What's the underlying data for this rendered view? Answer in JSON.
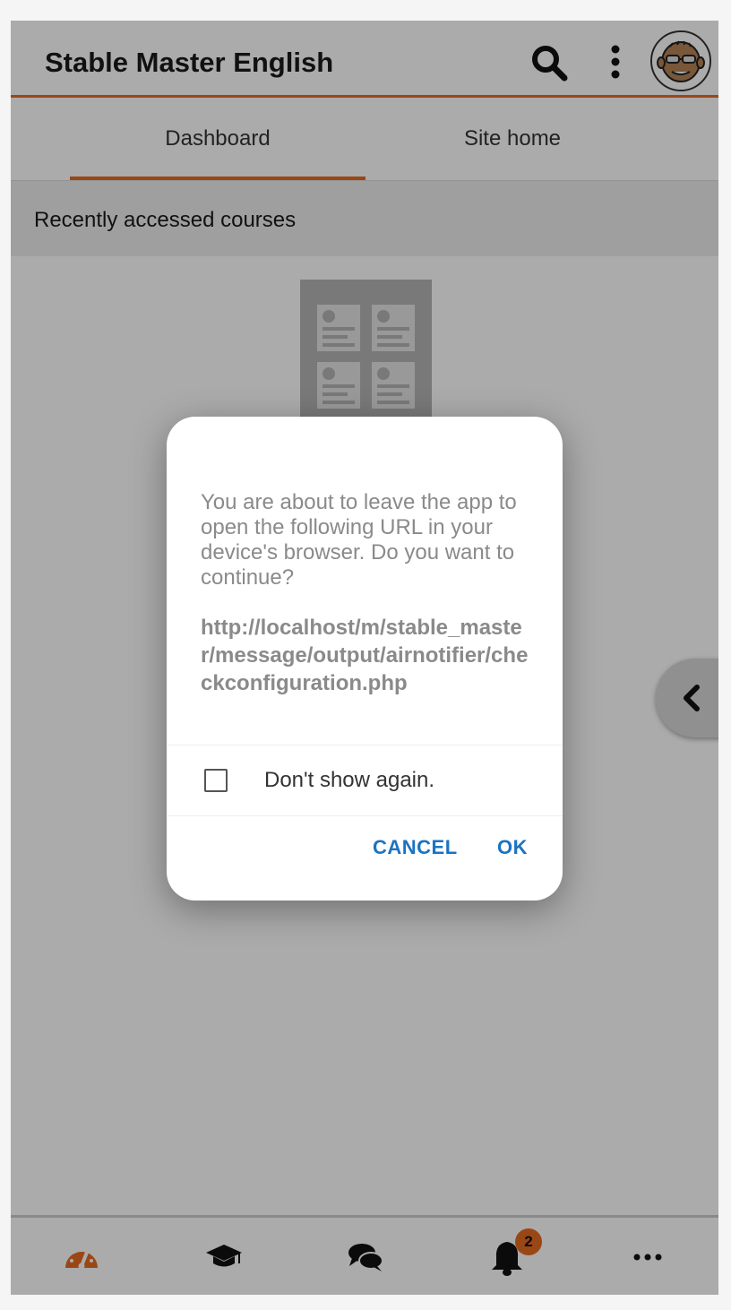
{
  "header": {
    "title": "Stable Master English",
    "search_icon": "search-icon",
    "more_icon": "kebab-menu-icon",
    "avatar": "user-avatar"
  },
  "tabs": [
    {
      "label": "Dashboard",
      "active": true
    },
    {
      "label": "Site home",
      "active": false
    }
  ],
  "section": {
    "title": "Recently accessed courses"
  },
  "bottom_nav": [
    {
      "name": "dashboard",
      "icon": "gauge-icon",
      "active": true
    },
    {
      "name": "courses",
      "icon": "graduation-cap-icon"
    },
    {
      "name": "messages",
      "icon": "chat-bubbles-icon"
    },
    {
      "name": "notifications",
      "icon": "bell-icon",
      "badge": "2"
    },
    {
      "name": "more",
      "icon": "ellipsis-icon"
    }
  ],
  "dialog": {
    "message": "You are about to leave the app to open the following URL in your device's browser. Do you want to continue?",
    "url": "http://localhost/m/stable_master/message/output/airnotifier/checkconfiguration.php",
    "checkbox_label": "Don't show again.",
    "checkbox_checked": false,
    "cancel_label": "CANCEL",
    "ok_label": "OK"
  },
  "colors": {
    "accent": "#e66a22",
    "button_text": "#1a73c4"
  }
}
